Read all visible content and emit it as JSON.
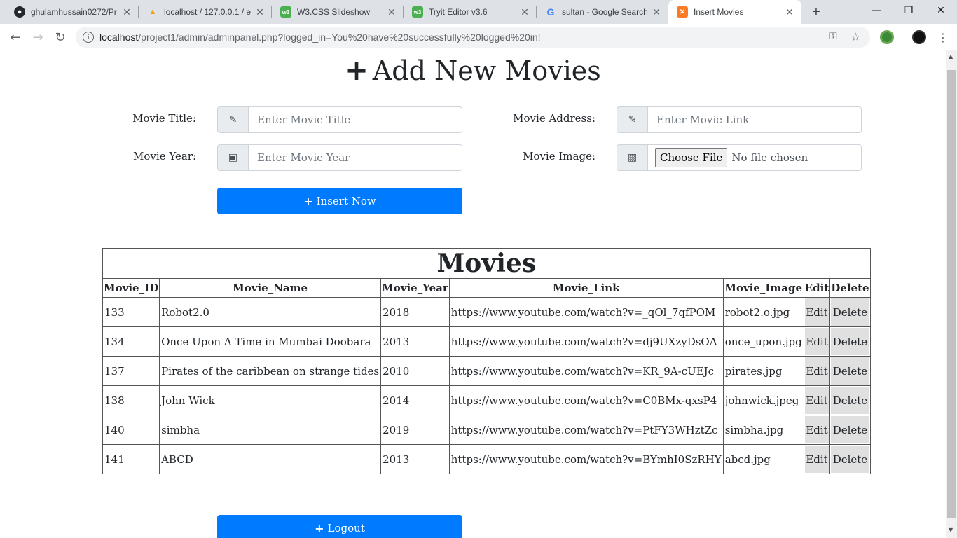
{
  "browser": {
    "tabs": [
      {
        "title": "ghulamhussain0272/Pr",
        "icon": "github-icon"
      },
      {
        "title": "localhost / 127.0.0.1 / e",
        "icon": "phpmyadmin-icon"
      },
      {
        "title": "W3.CSS Slideshow",
        "icon": "w3schools-icon"
      },
      {
        "title": "Tryit Editor v3.6",
        "icon": "w3schools-icon"
      },
      {
        "title": "sultan - Google Search",
        "icon": "google-icon"
      },
      {
        "title": "Insert Movies",
        "icon": "xampp-icon"
      }
    ],
    "url_host": "localhost",
    "url_path": "/project1/admin/adminpanel.php?logged_in=You%20have%20successfully%20logged%20in!"
  },
  "form": {
    "heading": "Add New Movies",
    "title_label": "Movie Title:",
    "title_placeholder": "Enter Movie Title",
    "address_label": "Movie Address:",
    "address_placeholder": "Enter Movie Link",
    "year_label": "Movie Year:",
    "year_placeholder": "Enter Movie Year",
    "image_label": "Movie Image:",
    "choose_file": "Choose File",
    "no_file": "No file chosen",
    "insert_label": "Insert Now"
  },
  "table": {
    "caption": "Movies",
    "headers": [
      "Movie_ID",
      "Movie_Name",
      "Movie_Year",
      "Movie_Link",
      "Movie_Image",
      "Edit",
      "Delete"
    ],
    "rows": [
      {
        "id": "133",
        "name": "Robot2.0",
        "year": "2018",
        "link": "https://www.youtube.com/watch?v=_qOl_7qfPOM",
        "image": "robot2.o.jpg",
        "edit": "Edit",
        "delete": "Delete"
      },
      {
        "id": "134",
        "name": "Once Upon A Time in Mumbai Doobara",
        "year": "2013",
        "link": "https://www.youtube.com/watch?v=dj9UXzyDsOA",
        "image": "once_upon.jpg",
        "edit": "Edit",
        "delete": "Delete"
      },
      {
        "id": "137",
        "name": "Pirates of the caribbean on strange tides",
        "year": "2010",
        "link": "https://www.youtube.com/watch?v=KR_9A-cUEJc",
        "image": "pirates.jpg",
        "edit": "Edit",
        "delete": "Delete"
      },
      {
        "id": "138",
        "name": "John Wick",
        "year": "2014",
        "link": "https://www.youtube.com/watch?v=C0BMx-qxsP4",
        "image": "johnwick.jpeg",
        "edit": "Edit",
        "delete": "Delete"
      },
      {
        "id": "140",
        "name": "simbha",
        "year": "2019",
        "link": "https://www.youtube.com/watch?v=PtFY3WHztZc",
        "image": "simbha.jpg",
        "edit": "Edit",
        "delete": "Delete"
      },
      {
        "id": "141",
        "name": "ABCD",
        "year": "2013",
        "link": "https://www.youtube.com/watch?v=BYmhI0SzRHY",
        "image": "abcd.jpg",
        "edit": "Edit",
        "delete": "Delete"
      }
    ]
  },
  "logout_label": "Logout",
  "colors": {
    "primary": "#007bff",
    "addon": "#e9ecef",
    "tab_bar": "#dee1e6"
  }
}
